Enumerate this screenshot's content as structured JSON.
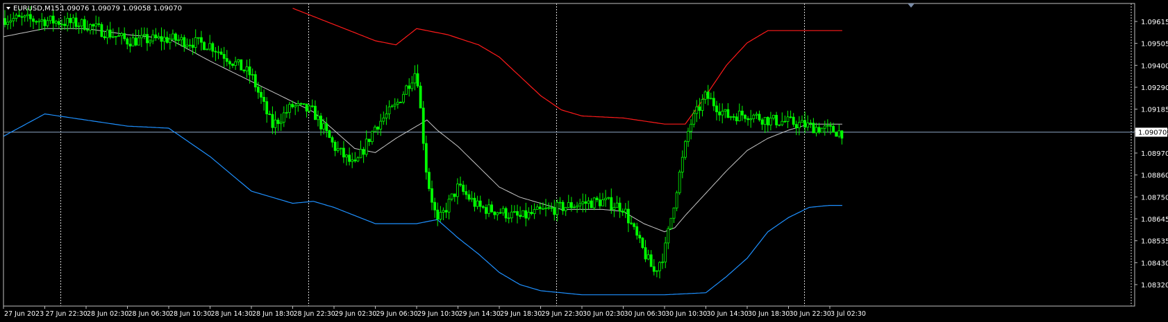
{
  "header": {
    "symbol_label": "EURUSD,M15",
    "ohlc_text": "1.09076 1.09079 1.09058 1.09070"
  },
  "colors": {
    "background": "#000000",
    "frame": "#c0c0c0",
    "candles": "#00ff00",
    "ma": "#c8c8c8",
    "upper_band": "#ff1a1a",
    "lower_band": "#1e90ff",
    "price_line": "#8fa9c8",
    "text": "#ffffff"
  },
  "chart_data": {
    "type": "candlestick",
    "instrument": "EURUSD",
    "timeframe": "M15",
    "current_price": 1.0907,
    "ylim": [
      1.0827,
      1.0968
    ],
    "y_ticks": [
      "1.09615",
      "1.09505",
      "1.09400",
      "1.09290",
      "1.09185",
      "1.09070",
      "1.08970",
      "1.08860",
      "1.08750",
      "1.08645",
      "1.08535",
      "1.08430",
      "1.08320"
    ],
    "current_price_label": "1.09070",
    "x_ticks": [
      "27 Jun 2023",
      "27 Jun 22:30",
      "28 Jun 02:30",
      "28 Jun 06:30",
      "28 Jun 10:30",
      "28 Jun 14:30",
      "28 Jun 18:30",
      "28 Jun 22:30",
      "29 Jun 02:30",
      "29 Jun 06:30",
      "29 Jun 10:30",
      "29 Jun 14:30",
      "29 Jun 18:30",
      "29 Jun 22:30",
      "30 Jun 02:30",
      "30 Jun 06:30",
      "30 Jun 10:30",
      "30 Jun 14:30",
      "30 Jun 18:30",
      "30 Jun 22:30",
      "3 Jul 02:30"
    ],
    "day_separators_at_tick": [
      1,
      7,
      13,
      19
    ],
    "price_path_anchors": [
      [
        0,
        1.0963
      ],
      [
        1,
        1.0962
      ],
      [
        2,
        1.096
      ],
      [
        3,
        1.0952
      ],
      [
        4,
        1.0953
      ],
      [
        5,
        1.095
      ],
      [
        6,
        1.0935
      ],
      [
        6.5,
        1.091
      ],
      [
        7,
        1.092
      ],
      [
        7.5,
        1.0917
      ],
      [
        8,
        1.09
      ],
      [
        8.5,
        1.089
      ],
      [
        9,
        1.091
      ],
      [
        9.5,
        1.092
      ],
      [
        10,
        1.0938
      ],
      [
        10.25,
        1.0885
      ],
      [
        10.5,
        1.0862
      ],
      [
        11,
        1.088
      ],
      [
        11.5,
        1.087
      ],
      [
        12,
        1.0868
      ],
      [
        12.5,
        1.0865
      ],
      [
        13,
        1.0868
      ],
      [
        13.5,
        1.087
      ],
      [
        14,
        1.0872
      ],
      [
        14.5,
        1.0873
      ],
      [
        15,
        1.087
      ],
      [
        15.4,
        1.0852
      ],
      [
        15.75,
        1.0838
      ],
      [
        16,
        1.0848
      ],
      [
        16.3,
        1.088
      ],
      [
        16.6,
        1.091
      ],
      [
        17,
        1.0925
      ],
      [
        17.5,
        1.0915
      ],
      [
        18,
        1.0916
      ],
      [
        18.5,
        1.0913
      ],
      [
        19,
        1.0912
      ],
      [
        19.5,
        1.091
      ],
      [
        20,
        1.0908
      ],
      [
        20.3,
        1.0907
      ]
    ],
    "upper_band_anchors": [
      [
        7,
        1.0968
      ],
      [
        8,
        1.096
      ],
      [
        9,
        1.0952
      ],
      [
        9.5,
        1.095
      ],
      [
        10,
        1.0958
      ],
      [
        10.75,
        1.0955
      ],
      [
        11.5,
        1.095
      ],
      [
        12,
        1.0944
      ],
      [
        13,
        1.0925
      ],
      [
        13.5,
        1.0918
      ],
      [
        14,
        1.0915
      ],
      [
        15,
        1.0914
      ],
      [
        16,
        1.0911
      ],
      [
        16.5,
        1.0911
      ],
      [
        17,
        1.0925
      ],
      [
        17.5,
        1.094
      ],
      [
        18,
        1.0951
      ],
      [
        18.5,
        1.0957
      ],
      [
        19,
        1.0957
      ],
      [
        20,
        1.0957
      ],
      [
        20.3,
        1.0957
      ]
    ],
    "lower_band_anchors": [
      [
        0,
        1.0905
      ],
      [
        1,
        1.0916
      ],
      [
        2,
        1.0913
      ],
      [
        3,
        1.091
      ],
      [
        4,
        1.0909
      ],
      [
        5,
        1.0895
      ],
      [
        6,
        1.0878
      ],
      [
        7,
        1.0872
      ],
      [
        7.5,
        1.0873
      ],
      [
        8,
        1.087
      ],
      [
        9,
        1.0862
      ],
      [
        10,
        1.0862
      ],
      [
        10.5,
        1.0864
      ],
      [
        11,
        1.0855
      ],
      [
        11.5,
        1.0847
      ],
      [
        12,
        1.0838
      ],
      [
        12.5,
        1.0832
      ],
      [
        13,
        1.0829
      ],
      [
        14,
        1.0827
      ],
      [
        15,
        1.0827
      ],
      [
        16,
        1.0827
      ],
      [
        17,
        1.0828
      ],
      [
        17.5,
        1.0836
      ],
      [
        18,
        1.0845
      ],
      [
        18.5,
        1.0858
      ],
      [
        19,
        1.0865
      ],
      [
        19.5,
        1.087
      ],
      [
        20,
        1.0871
      ],
      [
        20.3,
        1.0871
      ]
    ],
    "ma_anchors": [
      [
        0,
        1.0954
      ],
      [
        1,
        1.0958
      ],
      [
        2,
        1.0958
      ],
      [
        3,
        1.0955
      ],
      [
        4,
        1.0953
      ],
      [
        5,
        1.0942
      ],
      [
        6,
        1.0932
      ],
      [
        7,
        1.0922
      ],
      [
        7.5,
        1.0917
      ],
      [
        8,
        1.0908
      ],
      [
        8.5,
        1.0899
      ],
      [
        9,
        1.0897
      ],
      [
        9.5,
        1.0904
      ],
      [
        10,
        1.091
      ],
      [
        10.25,
        1.0913
      ],
      [
        10.5,
        1.0908
      ],
      [
        11,
        1.09
      ],
      [
        11.5,
        1.089
      ],
      [
        12,
        1.088
      ],
      [
        12.5,
        1.0875
      ],
      [
        13,
        1.0872
      ],
      [
        13.5,
        1.0869
      ],
      [
        14,
        1.0869
      ],
      [
        14.5,
        1.0869
      ],
      [
        15,
        1.0868
      ],
      [
        15.5,
        1.0862
      ],
      [
        16,
        1.0858
      ],
      [
        16.25,
        1.086
      ],
      [
        16.5,
        1.0866
      ],
      [
        17,
        1.0877
      ],
      [
        17.5,
        1.0888
      ],
      [
        18,
        1.0898
      ],
      [
        18.5,
        1.0904
      ],
      [
        19,
        1.0908
      ],
      [
        19.5,
        1.0911
      ],
      [
        20,
        1.0911
      ],
      [
        20.3,
        1.0911
      ]
    ]
  }
}
